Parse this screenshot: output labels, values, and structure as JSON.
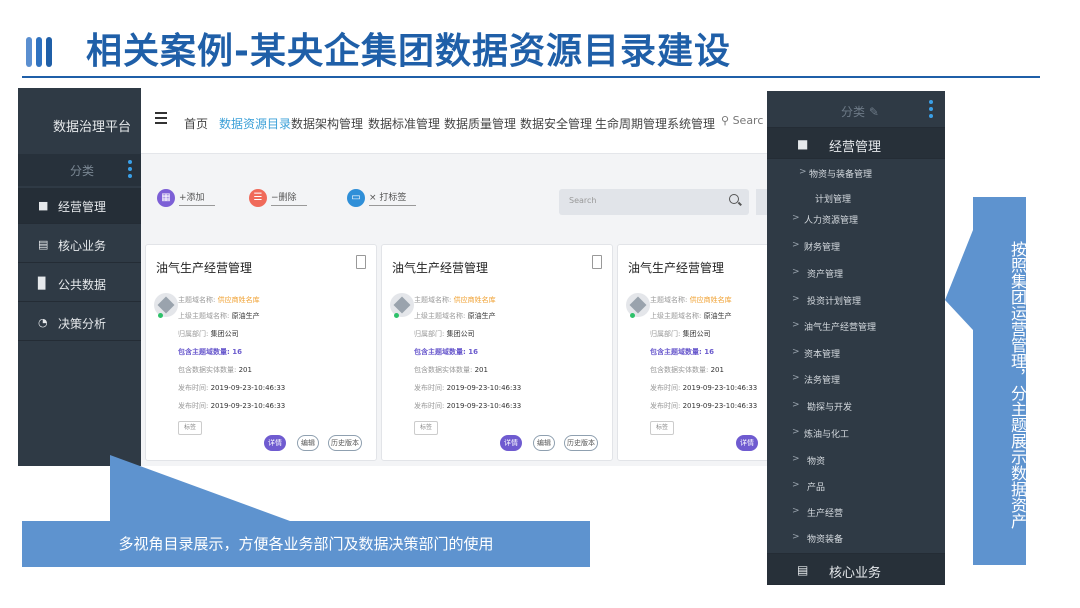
{
  "slide": {
    "title": "相关案例-某央企集团数据资源目录建设"
  },
  "app": {
    "brand": "数据治理平台",
    "category_label": "分类",
    "sidebar": [
      {
        "label": "经营管理",
        "icon": "cube-icon",
        "active": true
      },
      {
        "label": "核心业务",
        "icon": "document-icon",
        "active": false
      },
      {
        "label": "公共数据",
        "icon": "bar-chart-icon",
        "active": false
      },
      {
        "label": "决策分析",
        "icon": "pie-chart-icon",
        "active": false
      }
    ],
    "nav": [
      {
        "label": "首页",
        "active": false
      },
      {
        "label": "数据资源目录",
        "active": true
      },
      {
        "label": "数据架构管理",
        "active": false
      },
      {
        "label": "数据标准管理",
        "active": false
      },
      {
        "label": "数据质量管理",
        "active": false
      },
      {
        "label": "数据安全管理",
        "active": false
      },
      {
        "label": "生命周期管理",
        "active": false
      },
      {
        "label": "系统管理",
        "active": false
      }
    ],
    "nav_search": "Searc",
    "toolbar": {
      "add": "添加",
      "delete": "删除",
      "tag": "打标签",
      "search_placeholder": "Search"
    },
    "cards": [
      {
        "title": "油气生产经营管理",
        "topic_name_label": "主题域名称:",
        "topic_name": "供应商姓名库",
        "parent_label": "上级主题域名称:",
        "parent": "原油生产",
        "dept_label": "归属部门:",
        "dept": "集团公司",
        "sub_count_label": "包含主题域数量:",
        "sub_count": "16",
        "entity_count_label": "包含数据实体数量:",
        "entity_count": "201",
        "publish_label": "发布时间:",
        "publish_time": "2019-09-23-10:46:33",
        "update_label": "发布时间:",
        "update_time": "2019-09-23-10:46:33",
        "tag": "标签",
        "btn_detail": "详情",
        "btn_edit": "编辑",
        "btn_history": "历史版本"
      },
      {
        "title": "油气生产经营管理",
        "topic_name_label": "主题域名称:",
        "topic_name": "供应商姓名库",
        "parent_label": "上级主题域名称:",
        "parent": "原油生产",
        "dept_label": "归属部门:",
        "dept": "集团公司",
        "sub_count_label": "包含主题域数量:",
        "sub_count": "16",
        "entity_count_label": "包含数据实体数量:",
        "entity_count": "201",
        "publish_label": "发布时间:",
        "publish_time": "2019-09-23-10:46:33",
        "update_label": "发布时间:",
        "update_time": "2019-09-23-10:46:33",
        "tag": "标签",
        "btn_detail": "详情",
        "btn_edit": "编辑",
        "btn_history": "历史版本"
      },
      {
        "title": "油气生产经营管理",
        "topic_name_label": "主题域名称:",
        "topic_name": "供应商姓名库",
        "parent_label": "上级主题域名称:",
        "parent": "原油生产",
        "dept_label": "归属部门:",
        "dept": "集团公司",
        "sub_count_label": "包含主题域数量:",
        "sub_count": "16",
        "entity_count_label": "包含数据实体数量:",
        "entity_count": "201",
        "publish_label": "发布时间:",
        "publish_time": "2019-09-23-10:46:33",
        "update_label": "发布时间:",
        "update_time": "2019-09-23-10:46:33",
        "tag": "标签",
        "btn_detail": "详情"
      }
    ]
  },
  "right_panel": {
    "category_label": "分类",
    "header": "经营管理",
    "items": [
      {
        "label": "物资与装备管理"
      },
      {
        "label": "计划管理"
      },
      {
        "label": "人力资源管理"
      },
      {
        "label": "财务管理"
      },
      {
        "label": "资产管理"
      },
      {
        "label": "投资计划管理"
      },
      {
        "label": "油气生产经营管理"
      },
      {
        "label": "资本管理"
      },
      {
        "label": "法务管理"
      },
      {
        "label": "勘探与开发"
      },
      {
        "label": "炼油与化工"
      },
      {
        "label": "物资"
      },
      {
        "label": "产品"
      },
      {
        "label": "生产经营"
      },
      {
        "label": "物资装备"
      }
    ],
    "footer": "核心业务"
  },
  "callouts": {
    "bottom": "多视角目录展示，方便各业务部门及数据决策部门的使用",
    "right": "按照集团运营管理，分主题展示数据资产"
  },
  "colors": {
    "title_blue": "#1f5fa8",
    "callout_blue": "#5e93cf",
    "sidebar_dark": "#2f3a45",
    "accent_purple": "#6f5bd0",
    "nav_active": "#3ba0d8"
  }
}
